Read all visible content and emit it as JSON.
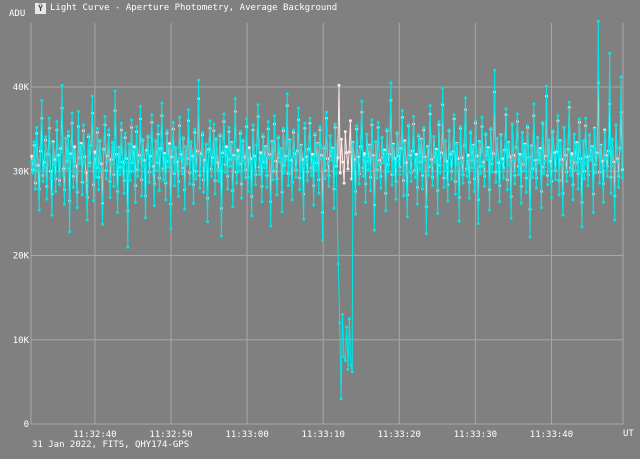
{
  "window": {
    "title": "Light Curve - Aperture Photometry, Average Background",
    "icon": "light-curve-app-icon"
  },
  "footer": "31 Jan 2022, FITS, QHY174-GPS",
  "colors": {
    "background": "#808080",
    "grid": "#a8a8a8",
    "series_cyan": "#00e8e8",
    "series_white": "#ffe8e8"
  },
  "chart_data": {
    "type": "line",
    "title": "Light Curve - Aperture Photometry, Average Background",
    "ylabel": "ADU",
    "xlabel": "UT",
    "ylim": [
      0,
      40000
    ],
    "yticks": [
      0,
      10000,
      20000,
      30000,
      40000
    ],
    "ytick_labels": [
      "0",
      "10K",
      "20K",
      "30K",
      "40K"
    ],
    "x_range": [
      "11:32:31.6",
      "11:33:49.4"
    ],
    "xtick_labels": [
      "11:32:40",
      "11:32:50",
      "11:33:00",
      "11:33:10",
      "11:33:20",
      "11:33:30",
      "11:33:40"
    ],
    "grid": true,
    "legend": "none",
    "series": [
      {
        "color": "#00e8e8",
        "baseline_mean": 31000,
        "noise_range": [
          21000,
          44000
        ],
        "dip": {
          "start": "11:33:11.9",
          "end": "11:33:13.9",
          "values": [
            19000,
            12000,
            3000,
            13000,
            8000,
            7500,
            11500,
            6500,
            12500,
            7000,
            6200
          ]
        },
        "samples": [
          31200,
          29800,
          33500,
          27900,
          35200,
          30100,
          25400,
          32800,
          38400,
          28800,
          30500,
          34100,
          26700,
          31900,
          36300,
          29200,
          24800,
          33300,
          30700,
          27600,
          35900,
          31400,
          28400,
          32200,
          40200,
          29500,
          26100,
          33900,
          30300,
          34700,
          22800,
          31600,
          36900,
          28100,
          32500,
          29900,
          25700,
          37100,
          30900,
          33100,
          27200,
          35500,
          31100,
          28600,
          24200,
          34300,
          30600,
          32900,
          38900,
          26500,
          31800,
          29300,
          35100,
          27800,
          33700,
          30200,
          23700,
          32300,
          36500,
          29100,
          31300,
          34900,
          26900,
          30800,
          33400,
          28200,
          39500,
          31700,
          25100,
          32700,
          29600,
          35700,
          30400,
          27400,
          34500,
          31000,
          21000,
          33200,
          28900,
          36100,
          30000,
          32600,
          26300,
          35300,
          29400,
          31500,
          37700,
          27100,
          33800,
          30600,
          24500,
          32100,
          34200,
          28700,
          31200,
          36700,
          29800,
          25900,
          33600,
          30100,
          35400,
          27700,
          32400,
          38100,
          29000,
          31900,
          26600,
          34800,
          30500,
          33000,
          23200,
          31100,
          35800,
          28300,
          32800,
          30300,
          27000,
          36400,
          31600,
          29700,
          34000,
          25500,
          32900,
          30900,
          37300,
          28500,
          33500,
          31400,
          26200,
          35000,
          29100,
          32000,
          40800,
          28000,
          31800,
          34600,
          27500,
          30700,
          33200,
          24000,
          32300,
          36000,
          29400,
          31000,
          35600,
          27300,
          33900,
          30200,
          28800,
          34400,
          22300,
          31700,
          36800,
          29900,
          32600,
          27900,
          35200,
          30600,
          33300,
          25800,
          31500,
          38600,
          28600,
          32100,
          30000,
          34700,
          26800,
          33700,
          31200,
          29200,
          36200,
          27600,
          32500,
          30800,
          24700,
          35500,
          31300,
          28400,
          33100,
          37900,
          29600,
          31900,
          26400,
          34300,
          30400,
          32800,
          28100,
          35900,
          31600,
          23500,
          33400,
          29000,
          36600,
          30300,
          27200,
          34100,
          31100,
          32700,
          25200,
          35100,
          29800,
          31400,
          39200,
          28300,
          33600,
          30700,
          26600,
          34900,
          31800,
          29300,
          32200,
          37500,
          27800,
          33000,
          30500,
          24300,
          35700,
          31000,
          28900,
          32400,
          36300,
          29500,
          31700,
          26000,
          34500,
          30100,
          33200,
          27400,
          35300,
          31500,
          21800,
          32900,
          29100,
          37000,
          30900,
          28200,
          34200,
          31300,
          32600,
          25600,
          35600,
          29700,
          31200,
          43800,
          28700,
          33800,
          30400,
          26900,
          34800,
          31900,
          29000,
          32000,
          36900,
          27500,
          33300,
          30600,
          24900,
          35400,
          31100,
          28500,
          32700,
          38300,
          29400,
          31600,
          26300,
          34400,
          30200,
          33000,
          27700,
          36100,
          31400,
          23000,
          33500,
          29200,
          35800,
          30800,
          28000,
          34000,
          31000,
          32300,
          25300,
          35000,
          29900,
          31800,
          40500,
          28400,
          33100,
          30500,
          26700,
          34600,
          31200,
          29600,
          32500,
          37200,
          27100,
          33400,
          30000,
          24600,
          35500,
          31500,
          28800,
          32200,
          36500,
          29300,
          31700,
          26100,
          34300,
          30300,
          33700,
          27900,
          35200,
          31300,
          22600,
          32800,
          29500,
          37800,
          30700,
          28300,
          34100,
          31100,
          32400,
          25000,
          35900,
          29800,
          31900,
          39900,
          28100,
          33600,
          30100,
          26500,
          34900,
          31600,
          29100,
          32100,
          36700,
          27300,
          33200,
          30900,
          24100,
          35300,
          31000,
          28600,
          32900,
          38700,
          29400,
          31500,
          26800,
          34700,
          30400,
          33000,
          27600,
          36000,
          31200,
          23800,
          33400,
          29700,
          36400,
          30600,
          28200,
          34500,
          31400,
          32600,
          25400,
          35100,
          29900,
          31800,
          42000,
          28700,
          33900,
          30200,
          26400,
          34200,
          31100,
          29200,
          32300,
          37400,
          27800,
          33300,
          30800,
          24400,
          35600,
          31300,
          28500,
          32700,
          36800,
          29600,
          31700,
          26200,
          34600,
          30000,
          33100,
          27500,
          35400,
          31500,
          22200,
          32900,
          29300,
          38000,
          30500,
          28000,
          34000,
          31000,
          32500,
          25700,
          35800,
          29700,
          31200,
          40100,
          28400,
          33700,
          30300,
          26900,
          34800,
          31800,
          29000,
          32000,
          36600,
          27200,
          33500,
          30700,
          24800,
          35200,
          31400,
          28800,
          32400,
          38200,
          29500,
          31600,
          26600,
          34400,
          30100,
          33200,
          27900,
          36200,
          31100,
          23400,
          33600,
          29100,
          36300,
          30900,
          28300,
          34300,
          31300,
          32800,
          25100,
          35000,
          29800,
          31900,
          47800,
          28600,
          33000,
          30400,
          26300,
          34700,
          31500,
          29400,
          32200,
          44000,
          27400,
          33800,
          30600,
          24200,
          35500,
          31200,
          28100,
          32600,
          41200,
          29200
        ]
      },
      {
        "color": "#ffe8e8",
        "baseline_mean": 31500,
        "noise_range": [
          23000,
          40500
        ],
        "samples": [
          31800,
          30200,
          33100,
          28600,
          34500,
          30700,
          27900,
          32400,
          36300,
          29500,
          31100,
          33700,
          28200,
          32000,
          35100,
          30000,
          27300,
          33500,
          31400,
          29100,
          34900,
          31900,
          28900,
          32700,
          37500,
          30300,
          27800,
          33900,
          31200,
          34200,
          26500,
          32100,
          35700,
          29400,
          32900,
          30600,
          27500,
          35300,
          31600,
          33300,
          28700,
          34800,
          31700,
          29800,
          26900,
          34100,
          31000,
          33000,
          36900,
          28400,
          32300,
          30400,
          34600,
          29300,
          33600,
          30900,
          26200,
          32600,
          35500,
          30100,
          31800,
          34300,
          28800,
          31400,
          33400,
          29600,
          37200,
          32000,
          27600,
          32800,
          30500,
          34900,
          31100,
          28900,
          34000,
          31500,
          25300,
          33200,
          30000,
          35200,
          31000,
          32900,
          28300,
          34700,
          30200,
          31900,
          36200,
          29000,
          33700,
          31300,
          27100,
          32500,
          34100,
          29900,
          31800,
          35800,
          30600,
          28500,
          33600,
          31000,
          34400,
          29200,
          32700,
          36600,
          30300,
          32100,
          28600,
          34500,
          31200,
          33300,
          26100,
          31700,
          35000,
          29700,
          32800,
          31100,
          28800,
          35400,
          32000,
          30400,
          33900,
          27800,
          32900,
          31500,
          36000,
          29800,
          33500,
          31800,
          28400,
          34600,
          30000,
          32400,
          38600,
          29500,
          32100,
          34300,
          29000,
          31300,
          33200,
          26800,
          32600,
          35100,
          30300,
          31600,
          34800,
          28900,
          33800,
          31000,
          30100,
          34200,
          25600,
          32200,
          35900,
          30800,
          32900,
          29400,
          34700,
          31400,
          33400,
          27700,
          31900,
          37100,
          29900,
          32500,
          30900,
          34500,
          28500,
          33600,
          31700,
          30200,
          35300,
          29300,
          32800,
          31500,
          27000,
          34900,
          31800,
          29600,
          33100,
          36500,
          30500,
          32200,
          28200,
          34100,
          31100,
          32900,
          29500,
          35000,
          32000,
          26400,
          33500,
          30000,
          35600,
          31200,
          29100,
          34000,
          31600,
          32700,
          27500,
          34800,
          30700,
          31800,
          37800,
          29700,
          33700,
          31300,
          28700,
          34600,
          32100,
          30200,
          32400,
          36100,
          29200,
          33100,
          31400,
          27300,
          35100,
          31700,
          29900,
          32600,
          35700,
          30400,
          32000,
          28300,
          34300,
          31000,
          33300,
          29000,
          34900,
          31900,
          25100,
          32800,
          30100,
          36300,
          31500,
          29500,
          34200,
          31800,
          32700,
          27900,
          35200,
          30600,
          31600,
          40200,
          29800,
          33800,
          31100,
          28600,
          34700,
          32200,
          30300,
          32300,
          36000,
          29100,
          33400,
          31400,
          27600,
          35000,
          31700,
          29700,
          32900,
          37000,
          30400,
          32100,
          28500,
          34400,
          31200,
          33100,
          29300,
          35500,
          31900,
          26000,
          33500,
          30200,
          35200,
          31300,
          29400,
          34000,
          31600,
          32500,
          27400,
          34800,
          30800,
          32000,
          38400,
          29600,
          33200,
          31500,
          28800,
          34500,
          31800,
          30500,
          32700,
          36400,
          28900,
          33600,
          31000,
          27200,
          35400,
          31900,
          29800,
          32400,
          35600,
          30100,
          32000,
          28100,
          34200,
          31100,
          33800,
          29500,
          34900,
          31700,
          25800,
          32900,
          30500,
          36800,
          31400,
          29300,
          34100,
          31700,
          32600,
          27700,
          35500,
          30700,
          32200,
          37900,
          29200,
          33600,
          31200,
          28400,
          34800,
          32000,
          30000,
          32300,
          36200,
          28800,
          33300,
          31500,
          26900,
          35100,
          31600,
          29600,
          33000,
          37300,
          30300,
          31900,
          28700,
          34600,
          31300,
          33100,
          29100,
          35700,
          31800,
          26600,
          33500,
          30600,
          35300,
          31100,
          29400,
          34400,
          31900,
          32800,
          27800,
          35000,
          30900,
          32100,
          39400,
          29900,
          33900,
          31000,
          28300,
          34300,
          31500,
          30400,
          32500,
          36700,
          29000,
          33400,
          31700,
          27000,
          35600,
          31900,
          29500,
          32800,
          35900,
          30600,
          32000,
          28200,
          34600,
          30800,
          33200,
          29200,
          35200,
          31600,
          25500,
          33000,
          30300,
          36600,
          31300,
          29200,
          34000,
          31400,
          32700,
          27600,
          35700,
          30500,
          31800,
          38900,
          29500,
          33700,
          31200,
          28800,
          34700,
          32200,
          30100,
          32300,
          36000,
          28900,
          33600,
          31400,
          27400,
          35200,
          31900,
          29900,
          32600,
          37600,
          30400,
          32100,
          28400,
          34400,
          31000,
          33400,
          29700,
          35800,
          31500,
          26300,
          33600,
          30000,
          35400,
          31700,
          29600,
          34300,
          31800,
          32900,
          27300,
          35100,
          30800,
          32200,
          40500,
          29900,
          33100,
          31200,
          28500,
          34900,
          31900,
          30600,
          32400,
          38000,
          29300,
          33800,
          31100,
          27100,
          35500,
          31500,
          29400,
          32700,
          37000,
          30200
        ]
      }
    ]
  }
}
